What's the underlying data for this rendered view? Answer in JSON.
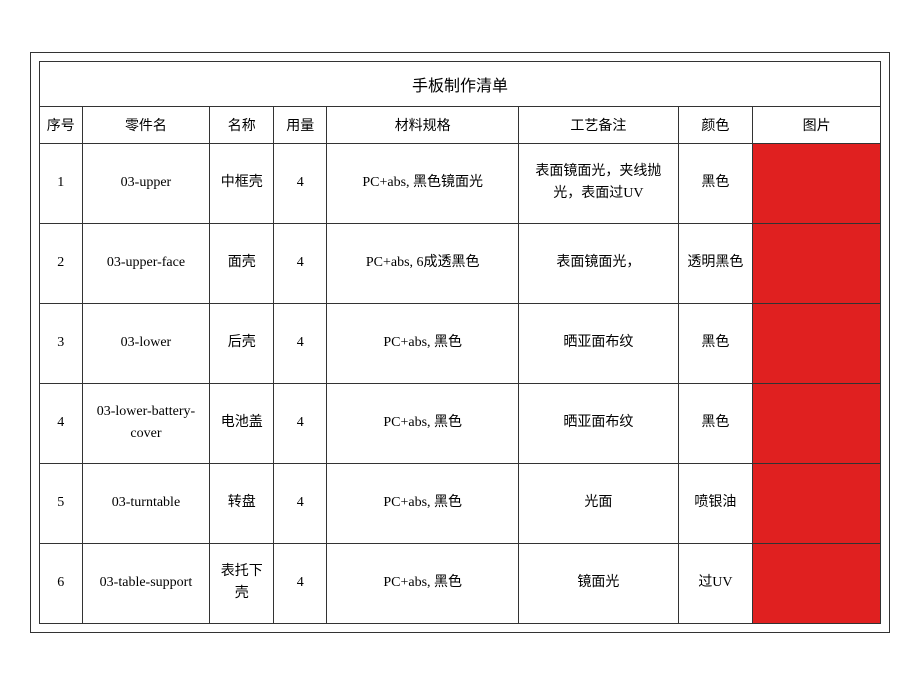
{
  "title": "手板制作清单",
  "headers": {
    "seq": "序号",
    "partname": "零件名",
    "name": "名称",
    "qty": "用量",
    "material": "材料规格",
    "process": "工艺备注",
    "color": "颜色",
    "image": "图片"
  },
  "rows": [
    {
      "seq": "1",
      "partname": "03-upper",
      "name": "中框壳",
      "qty": "4",
      "material": "PC+abs, 黑色镜面光",
      "process": "表面镜面光，夹线抛光，表面过UV",
      "color": "黑色"
    },
    {
      "seq": "2",
      "partname": "03-upper-face",
      "name": "面壳",
      "qty": "4",
      "material": "PC+abs, 6成透黑色",
      "process": "表面镜面光，",
      "color": "透明黑色"
    },
    {
      "seq": "3",
      "partname": "03-lower",
      "name": "后壳",
      "qty": "4",
      "material": "PC+abs, 黑色",
      "process": "晒亚面布纹",
      "color": "黑色"
    },
    {
      "seq": "4",
      "partname": "03-lower-battery-cover",
      "name": "电池盖",
      "qty": "4",
      "material": "PC+abs, 黑色",
      "process": "晒亚面布纹",
      "color": "黑色"
    },
    {
      "seq": "5",
      "partname": "03-turntable",
      "name": "转盘",
      "qty": "4",
      "material": "PC+abs, 黑色",
      "process": "光面",
      "color": "喷银油"
    },
    {
      "seq": "6",
      "partname": "03-table-support",
      "name": "表托下壳",
      "qty": "4",
      "material": "PC+abs, 黑色",
      "process": "镜面光",
      "color": "过UV"
    }
  ]
}
